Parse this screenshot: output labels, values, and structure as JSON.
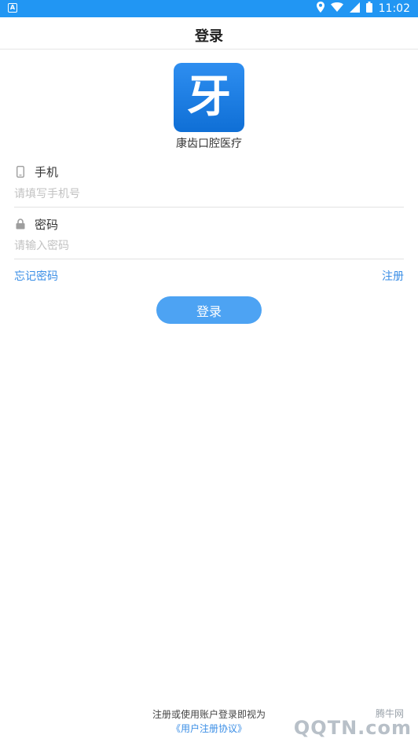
{
  "status_bar": {
    "time": "11:02",
    "left_icon": "A"
  },
  "header": {
    "title": "登录"
  },
  "brand": {
    "logo_char": "牙",
    "app_name": "康齿口腔医疗"
  },
  "form": {
    "phone": {
      "label": "手机",
      "placeholder": "请填写手机号",
      "icon": "phone-icon"
    },
    "password": {
      "label": "密码",
      "placeholder": "请输入密码",
      "icon": "lock-icon"
    }
  },
  "links": {
    "forgot": "忘记密码",
    "register": "注册"
  },
  "actions": {
    "login": "登录"
  },
  "footer": {
    "agreement_text": "注册或使用账户登录即视为",
    "agreement_link": "《用户注册协议》"
  },
  "watermark": {
    "brand": "QQTN.com",
    "small": "腾牛网"
  },
  "colors": {
    "primary": "#2196f3",
    "button": "#4da3f3",
    "link": "#3a8ee6"
  }
}
